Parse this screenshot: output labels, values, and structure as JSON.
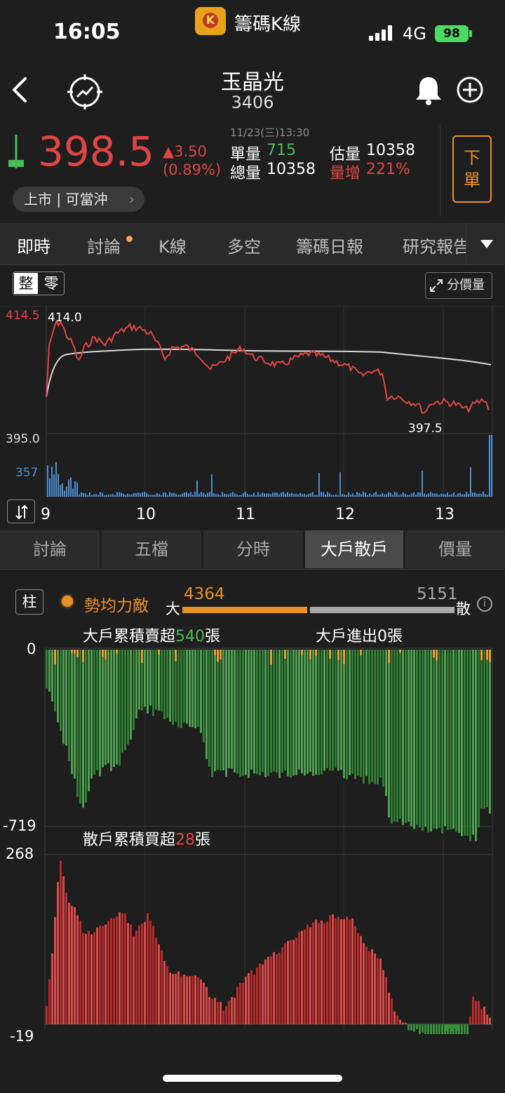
{
  "status_bar": {
    "time": "16:05",
    "app_name": "籌碼K線",
    "network": "4G",
    "battery": "98"
  },
  "stock": {
    "name": "玉晶光",
    "code": "3406",
    "price": "398.5",
    "change": "▲3.50",
    "change_pct": "(0.89%)",
    "datetime": "11/23(三)13:30"
  },
  "quote": {
    "unit_vol_label": "單量",
    "unit_vol": "715",
    "est_vol_label": "估量",
    "est_vol": "10358",
    "total_vol_label": "總量",
    "total_vol": "10358",
    "vol_inc_label": "量增",
    "vol_inc": "221%"
  },
  "order_button": "下單",
  "market_pill": "上市 | 可當沖",
  "tabs": [
    "即時",
    "討論",
    "K線",
    "多空",
    "籌碼日報",
    "研究報告"
  ],
  "intraday": {
    "toggle": [
      "整",
      "零"
    ],
    "price_volume_button": "分價量",
    "y_high": "414.5",
    "y_low": "395.0",
    "high_label": "414.0",
    "low_label": "397.5",
    "vol_max": "357",
    "time_labels": [
      "9",
      "10",
      "11",
      "12",
      "13"
    ]
  },
  "sub_tabs": [
    "討論",
    "五檔",
    "分時",
    "大戶散戶",
    "價量"
  ],
  "big_small": {
    "pillar": "柱",
    "trend_label": "勢均力敵",
    "big_label": "大",
    "big_value": "4364",
    "small_value": "5151",
    "small_label": "散",
    "big_ratio": 0.4587,
    "big_title_prefix": "大戶累積賣超",
    "big_title_value": "540",
    "big_title_unit": "張",
    "big_inout": "大戶進出0張",
    "big_y_top": "0",
    "big_y_bottom": "-719",
    "small_title_prefix": "散戶累積買超",
    "small_title_value": "28",
    "small_title_unit": "張",
    "small_y_top": "268",
    "small_y_bottom": "-19"
  },
  "colors": {
    "up": "#e04545",
    "down": "#4cbb5a",
    "accent": "#e8902a",
    "avg_line": "#d8d8d8",
    "volume": "#4a90d9"
  }
}
